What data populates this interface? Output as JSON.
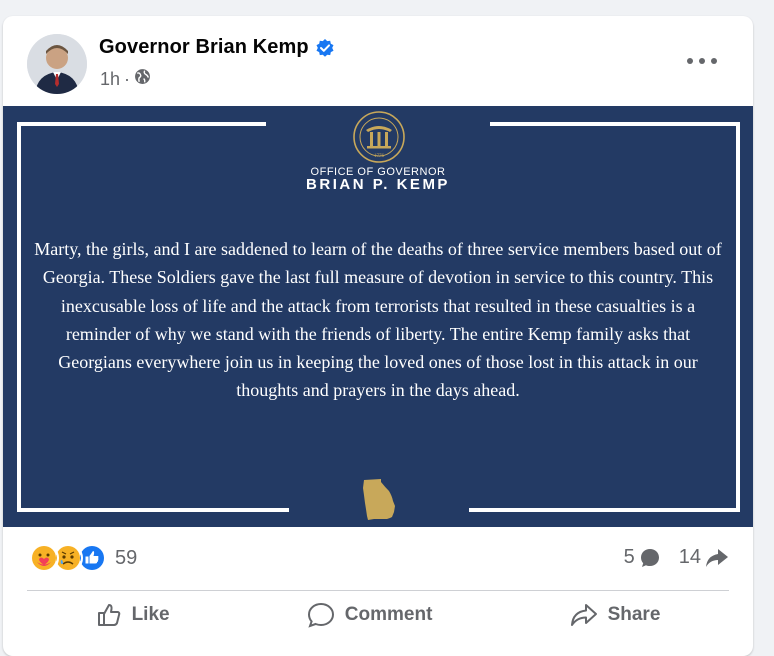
{
  "post": {
    "author": "Governor Brian Kemp",
    "time": "1h",
    "separator": "·",
    "privacy_icon": "globe-icon",
    "verified_icon": "verified-badge-icon",
    "more_icon": "more-options-icon"
  },
  "image": {
    "background_color": "#233a64",
    "office_line": "OFFICE OF GOVERNOR",
    "governor_name": "BRIAN P. KEMP",
    "seal_year": "1776",
    "seal_icon": "georgia-state-seal",
    "map_icon": "georgia-state-map",
    "statement": "Marty, the girls, and I are saddened to learn of the deaths of three service members based out of Georgia. These Soldiers gave the last full measure of devotion in service to this country. This inexcusable loss of life and the attack from terrorists that resulted in these casualties is a reminder of why we stand with the friends of liberty. The entire Kemp family asks that Georgians everywhere join us in keeping the loved ones of those lost in this attack in our thoughts and prayers in the days ahead."
  },
  "engagement": {
    "reaction_icons": [
      "care-reaction-icon",
      "sad-reaction-icon",
      "like-reaction-icon"
    ],
    "reaction_count": "59",
    "comment_count": "5",
    "share_count": "14"
  },
  "actions": {
    "like": "Like",
    "comment": "Comment",
    "share": "Share"
  },
  "colors": {
    "facebook_blue": "#1877f2",
    "seal_gold": "#c8a85a"
  }
}
